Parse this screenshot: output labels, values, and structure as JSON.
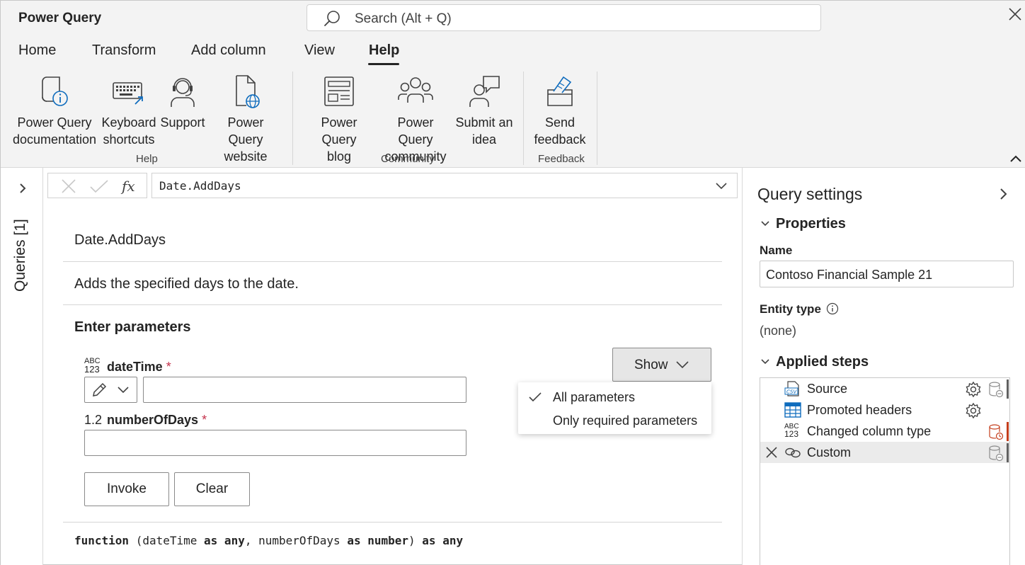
{
  "app": {
    "title": "Power Query"
  },
  "search": {
    "placeholder": "Search (Alt + Q)"
  },
  "tabs": [
    {
      "label": "Home"
    },
    {
      "label": "Transform"
    },
    {
      "label": "Add column"
    },
    {
      "label": "View"
    },
    {
      "label": "Help",
      "active": true
    }
  ],
  "ribbon": {
    "groups": [
      {
        "label": "Help",
        "buttons": [
          {
            "label": "Power Query\ndocumentation",
            "icon": "document-info-icon"
          },
          {
            "label": "Keyboard\nshortcuts",
            "icon": "keyboard-icon"
          },
          {
            "label": "Support",
            "icon": "headset-icon"
          },
          {
            "label": "Power Query\nwebsite",
            "icon": "web-page-icon"
          }
        ]
      },
      {
        "label": "Community",
        "buttons": [
          {
            "label": "Power Query\nblog",
            "icon": "blog-icon"
          },
          {
            "label": "Power Query\ncommunity",
            "icon": "people-icon"
          },
          {
            "label": "Submit an\nidea",
            "icon": "person-chat-icon"
          }
        ]
      },
      {
        "label": "Feedback",
        "buttons": [
          {
            "label": "Send\nfeedback",
            "icon": "feedback-box-icon"
          }
        ]
      }
    ]
  },
  "queries_rail": {
    "label": "Queries [1]"
  },
  "formula_bar": {
    "value": "Date.AddDays"
  },
  "function": {
    "name": "Date.AddDays",
    "description": "Adds the specified days to the date.",
    "enter_params_label": "Enter parameters",
    "params": [
      {
        "type_top": "ABC",
        "type_bottom": "123",
        "name": "dateTime",
        "required_mark": "*",
        "value": ""
      },
      {
        "type": "1.2",
        "name": "numberOfDays",
        "required_mark": "*",
        "value": ""
      }
    ],
    "invoke_label": "Invoke",
    "clear_label": "Clear",
    "show_label": "Show",
    "show_options": [
      {
        "label": "All parameters",
        "checked": true
      },
      {
        "label": "Only required parameters",
        "checked": false
      }
    ],
    "signature": {
      "kw_function": "function",
      "p1": " (dateTime ",
      "kw_as1": "as",
      "kw_any1": " any",
      "p2": ", numberOfDays ",
      "kw_as2": "as",
      "kw_number": " number",
      "p3": ") ",
      "kw_as3": "as",
      "kw_any2": " any"
    }
  },
  "settings": {
    "title": "Query settings",
    "properties_label": "Properties",
    "name_label": "Name",
    "name_value": "Contoso Financial Sample 21",
    "entity_type_label": "Entity type",
    "entity_type_value": "(none)",
    "applied_steps_label": "Applied steps",
    "steps": [
      {
        "name": "Source",
        "icon": "csv-icon",
        "has_gear": true,
        "status": "normal"
      },
      {
        "name": "Promoted headers",
        "icon": "table-icon",
        "has_gear": true,
        "status": "none"
      },
      {
        "name": "Changed column type",
        "icon": "abc-123-icon",
        "has_gear": false,
        "status": "warning"
      },
      {
        "name": "Custom",
        "icon": "link-icon",
        "has_gear": false,
        "status": "normal",
        "selected": true
      }
    ]
  },
  "colors": {
    "accent_dark": "#242424",
    "warning": "#c43e1c",
    "required": "#c4314b",
    "chrome": "#f3f3f3"
  }
}
